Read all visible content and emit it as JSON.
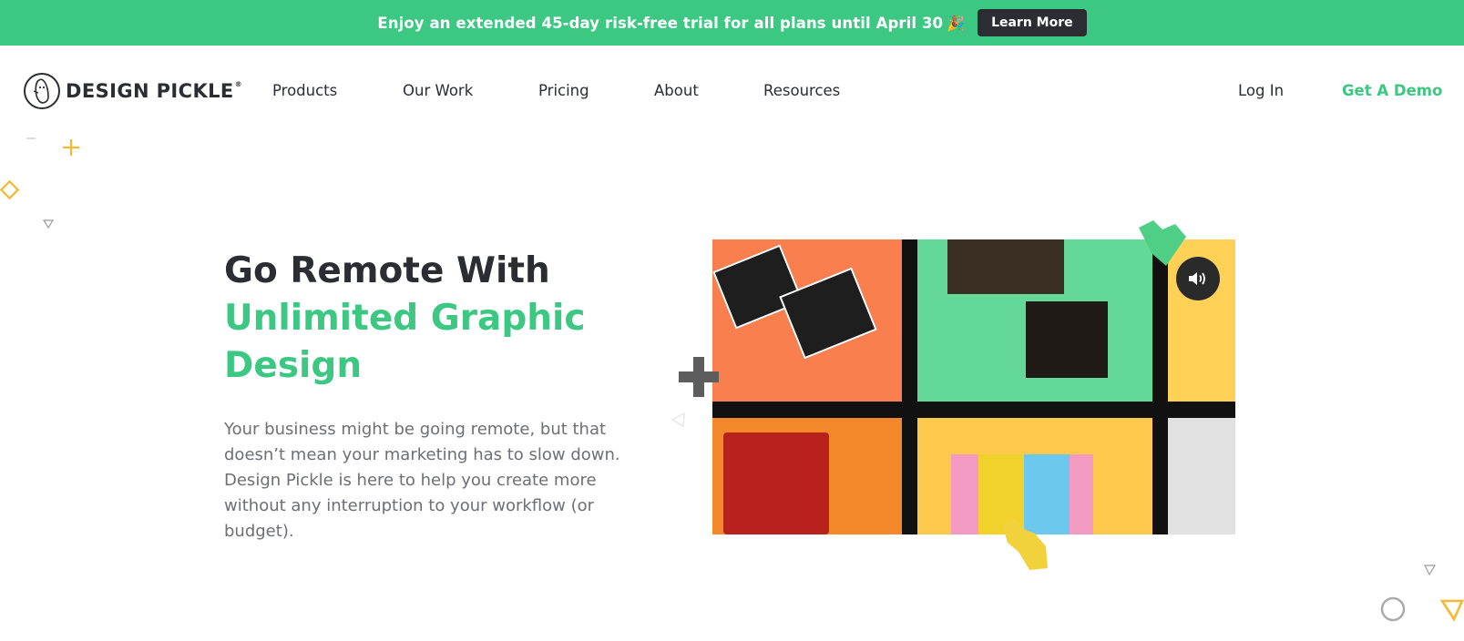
{
  "promo": {
    "text": "Enjoy an extended 45-day risk-free trial for all plans until April 30",
    "emoji": "🎉",
    "button_label": "Learn More"
  },
  "brand": {
    "name": "DESIGN PICKLE",
    "reg": "®"
  },
  "nav": {
    "items": [
      "Products",
      "Our Work",
      "Pricing",
      "About",
      "Resources"
    ],
    "login": "Log In",
    "demo": "Get A Demo"
  },
  "hero": {
    "title_line1": "Go Remote With",
    "title_accent": "Unlimited Graphic Design",
    "body": "Your business might be going remote, but that doesn’t mean your marketing has to slow down. Design Pickle is here to help you create more without any interruption to your workflow (or budget)."
  },
  "video": {
    "sound_icon": "speaker-volume-icon"
  },
  "colors": {
    "accent": "#3cc882",
    "dark": "#2b2d33",
    "body_text": "#6d6f75",
    "yellow": "#f5b82e"
  }
}
